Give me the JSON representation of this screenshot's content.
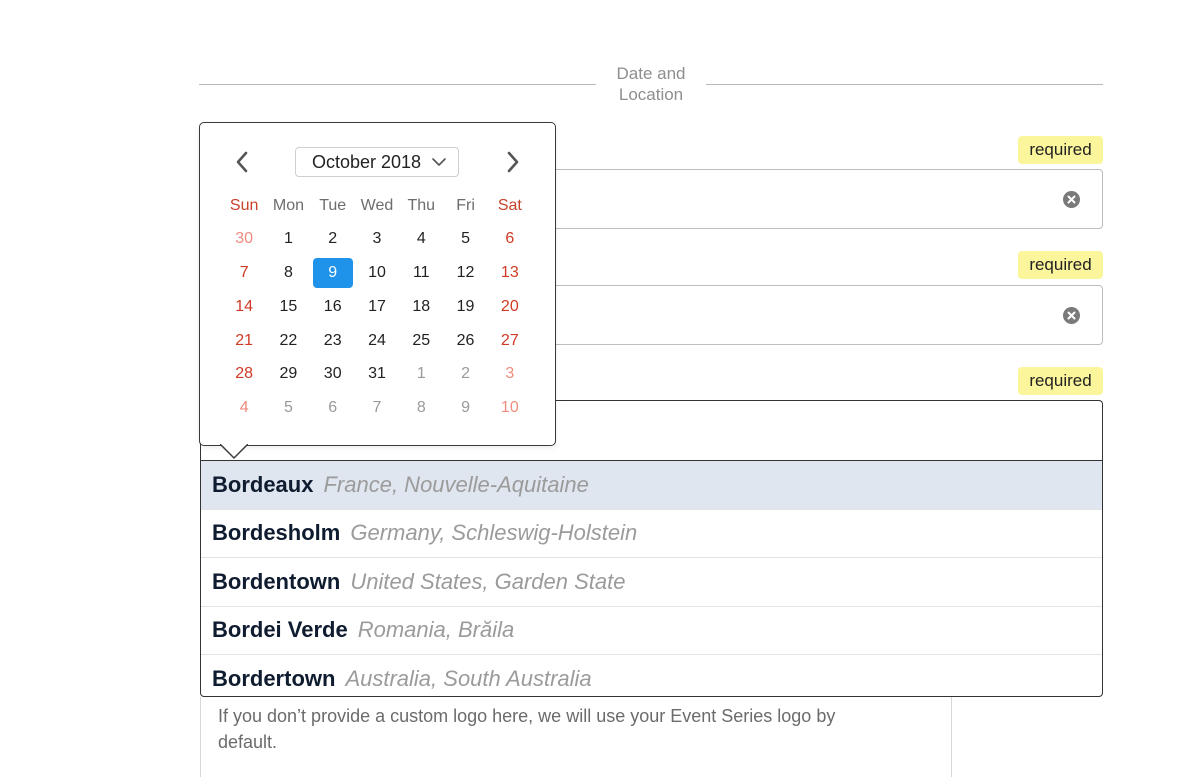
{
  "section": {
    "title_line1": "Date and",
    "title_line2": "Location"
  },
  "fields": {
    "start_date": {
      "badge": "required"
    },
    "end_date": {
      "badge": "required"
    },
    "location": {
      "badge": "required"
    }
  },
  "calendar": {
    "month_label": "October 2018",
    "weekdays": [
      "Sun",
      "Mon",
      "Tue",
      "Wed",
      "Thu",
      "Fri",
      "Sat"
    ],
    "weeks": [
      [
        "30",
        "1",
        "2",
        "3",
        "4",
        "5",
        "6"
      ],
      [
        "7",
        "8",
        "9",
        "10",
        "11",
        "12",
        "13"
      ],
      [
        "14",
        "15",
        "16",
        "17",
        "18",
        "19",
        "20"
      ],
      [
        "21",
        "22",
        "23",
        "24",
        "25",
        "26",
        "27"
      ],
      [
        "28",
        "29",
        "30",
        "31",
        "1",
        "2",
        "3"
      ],
      [
        "4",
        "5",
        "6",
        "7",
        "8",
        "9",
        "10"
      ]
    ],
    "selected_day": "9",
    "colors": {
      "weekend": "#d03a24",
      "selected": "#1f93ea"
    }
  },
  "autocomplete": {
    "options": [
      {
        "city": "Bordeaux",
        "region": "France, Nouvelle-Aquitaine"
      },
      {
        "city": "Bordesholm",
        "region": "Germany, Schleswig-Holstein"
      },
      {
        "city": "Bordentown",
        "region": "United States, Garden State"
      },
      {
        "city": "Bordei Verde",
        "region": "Romania, Brăila"
      },
      {
        "city": "Bordertown",
        "region": "Australia, South Australia"
      }
    ]
  },
  "logo_help": "If you don’t provide a custom logo here, we will use your Event Series logo by default."
}
